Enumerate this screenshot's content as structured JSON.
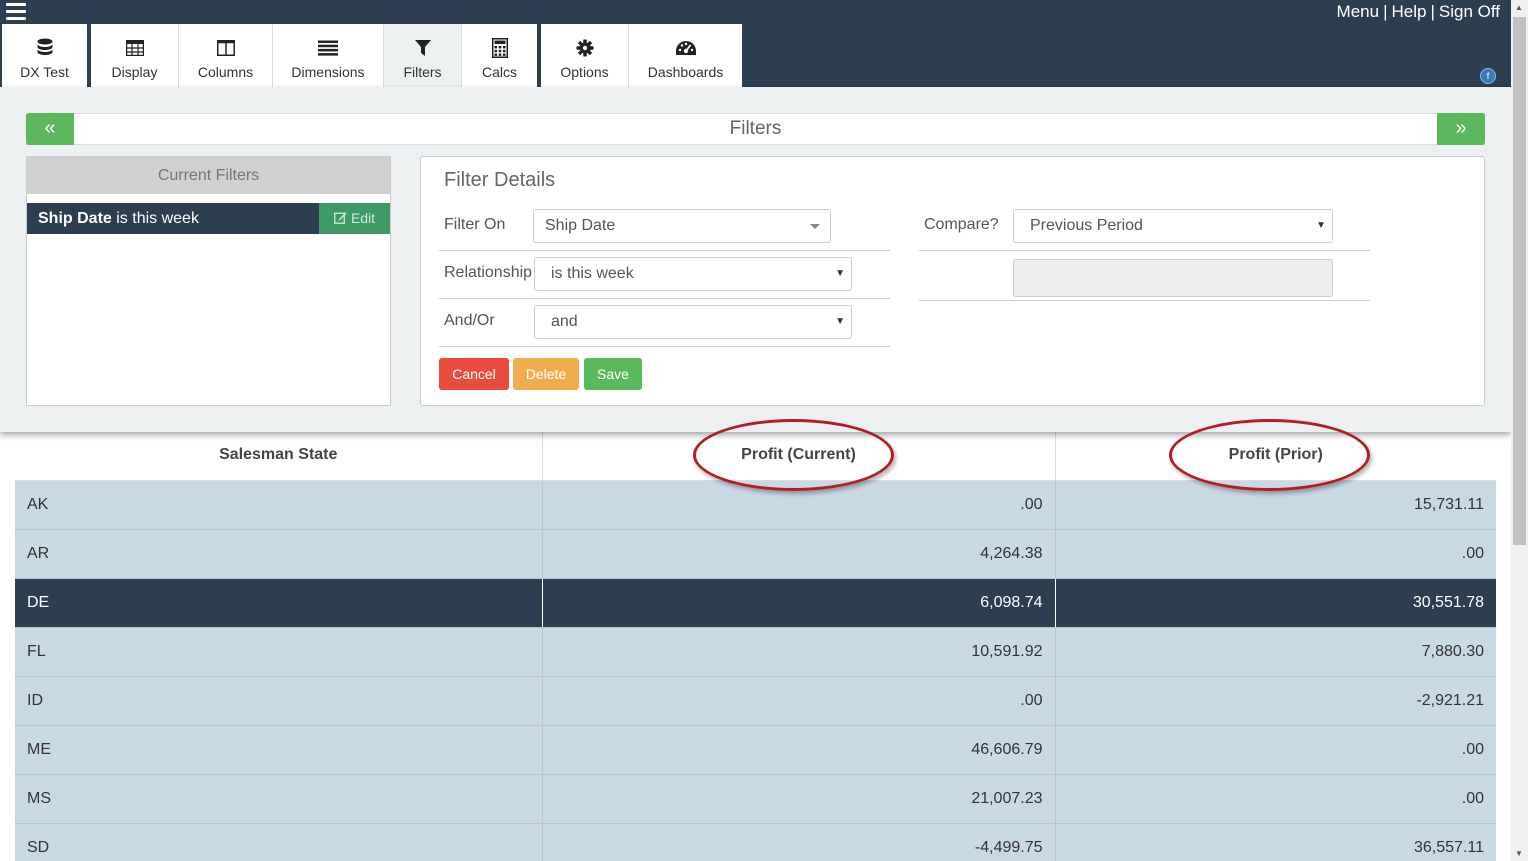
{
  "header": {
    "links": [
      "Menu",
      "Help",
      "Sign Off"
    ]
  },
  "tabs": [
    {
      "label": "DX Test",
      "icon": "database-icon"
    },
    {
      "label": "Display",
      "icon": "table-grid-icon"
    },
    {
      "label": "Columns",
      "icon": "columns-icon"
    },
    {
      "label": "Dimensions",
      "icon": "list-lines-icon"
    },
    {
      "label": "Filters",
      "icon": "filter-icon"
    },
    {
      "label": "Calcs",
      "icon": "calculator-icon"
    },
    {
      "label": "Options",
      "icon": "gear-icon"
    },
    {
      "label": "Dashboards",
      "icon": "dashboard-gauge-icon"
    }
  ],
  "active_tab": "Filters",
  "filters_panel": {
    "title": "Filters",
    "prev_label": "«",
    "next_label": "»",
    "current_filters": {
      "heading": "Current Filters",
      "items": [
        {
          "field": "Ship Date",
          "condition": " is this week",
          "edit_label": "Edit"
        }
      ]
    },
    "details": {
      "title": "Filter Details",
      "filter_on_label": "Filter On",
      "filter_on_value": "Ship Date",
      "relationship_label": "Relationship",
      "relationship_value": "is this week",
      "and_or_label": "And/Or",
      "and_or_value": "and",
      "compare_label": "Compare?",
      "compare_value": "Previous Period",
      "cancel_label": "Cancel",
      "delete_label": "Delete",
      "save_label": "Save"
    }
  },
  "table": {
    "columns": [
      "Salesman State",
      "Profit (Current)",
      "Profit (Prior)"
    ],
    "rows": [
      {
        "state": "AK",
        "current": ".00",
        "prior": "15,731.11",
        "selected": false
      },
      {
        "state": "AR",
        "current": "4,264.38",
        "prior": ".00",
        "selected": false
      },
      {
        "state": "DE",
        "current": "6,098.74",
        "prior": "30,551.78",
        "selected": true
      },
      {
        "state": "FL",
        "current": "10,591.92",
        "prior": "7,880.30",
        "selected": false
      },
      {
        "state": "ID",
        "current": ".00",
        "prior": "-2,921.21",
        "selected": false
      },
      {
        "state": "ME",
        "current": "46,606.79",
        "prior": ".00",
        "selected": false
      },
      {
        "state": "MS",
        "current": "21,007.23",
        "prior": ".00",
        "selected": false
      },
      {
        "state": "SD",
        "current": "-4,499.75",
        "prior": "36,557.11",
        "selected": false
      }
    ]
  },
  "colors": {
    "navy": "#2c3e50",
    "green": "#5cb85c",
    "red": "#e74c3c",
    "orange": "#f0ad4e",
    "row_bg": "#c9d9e4",
    "annotation_circle": "#b21e23"
  }
}
